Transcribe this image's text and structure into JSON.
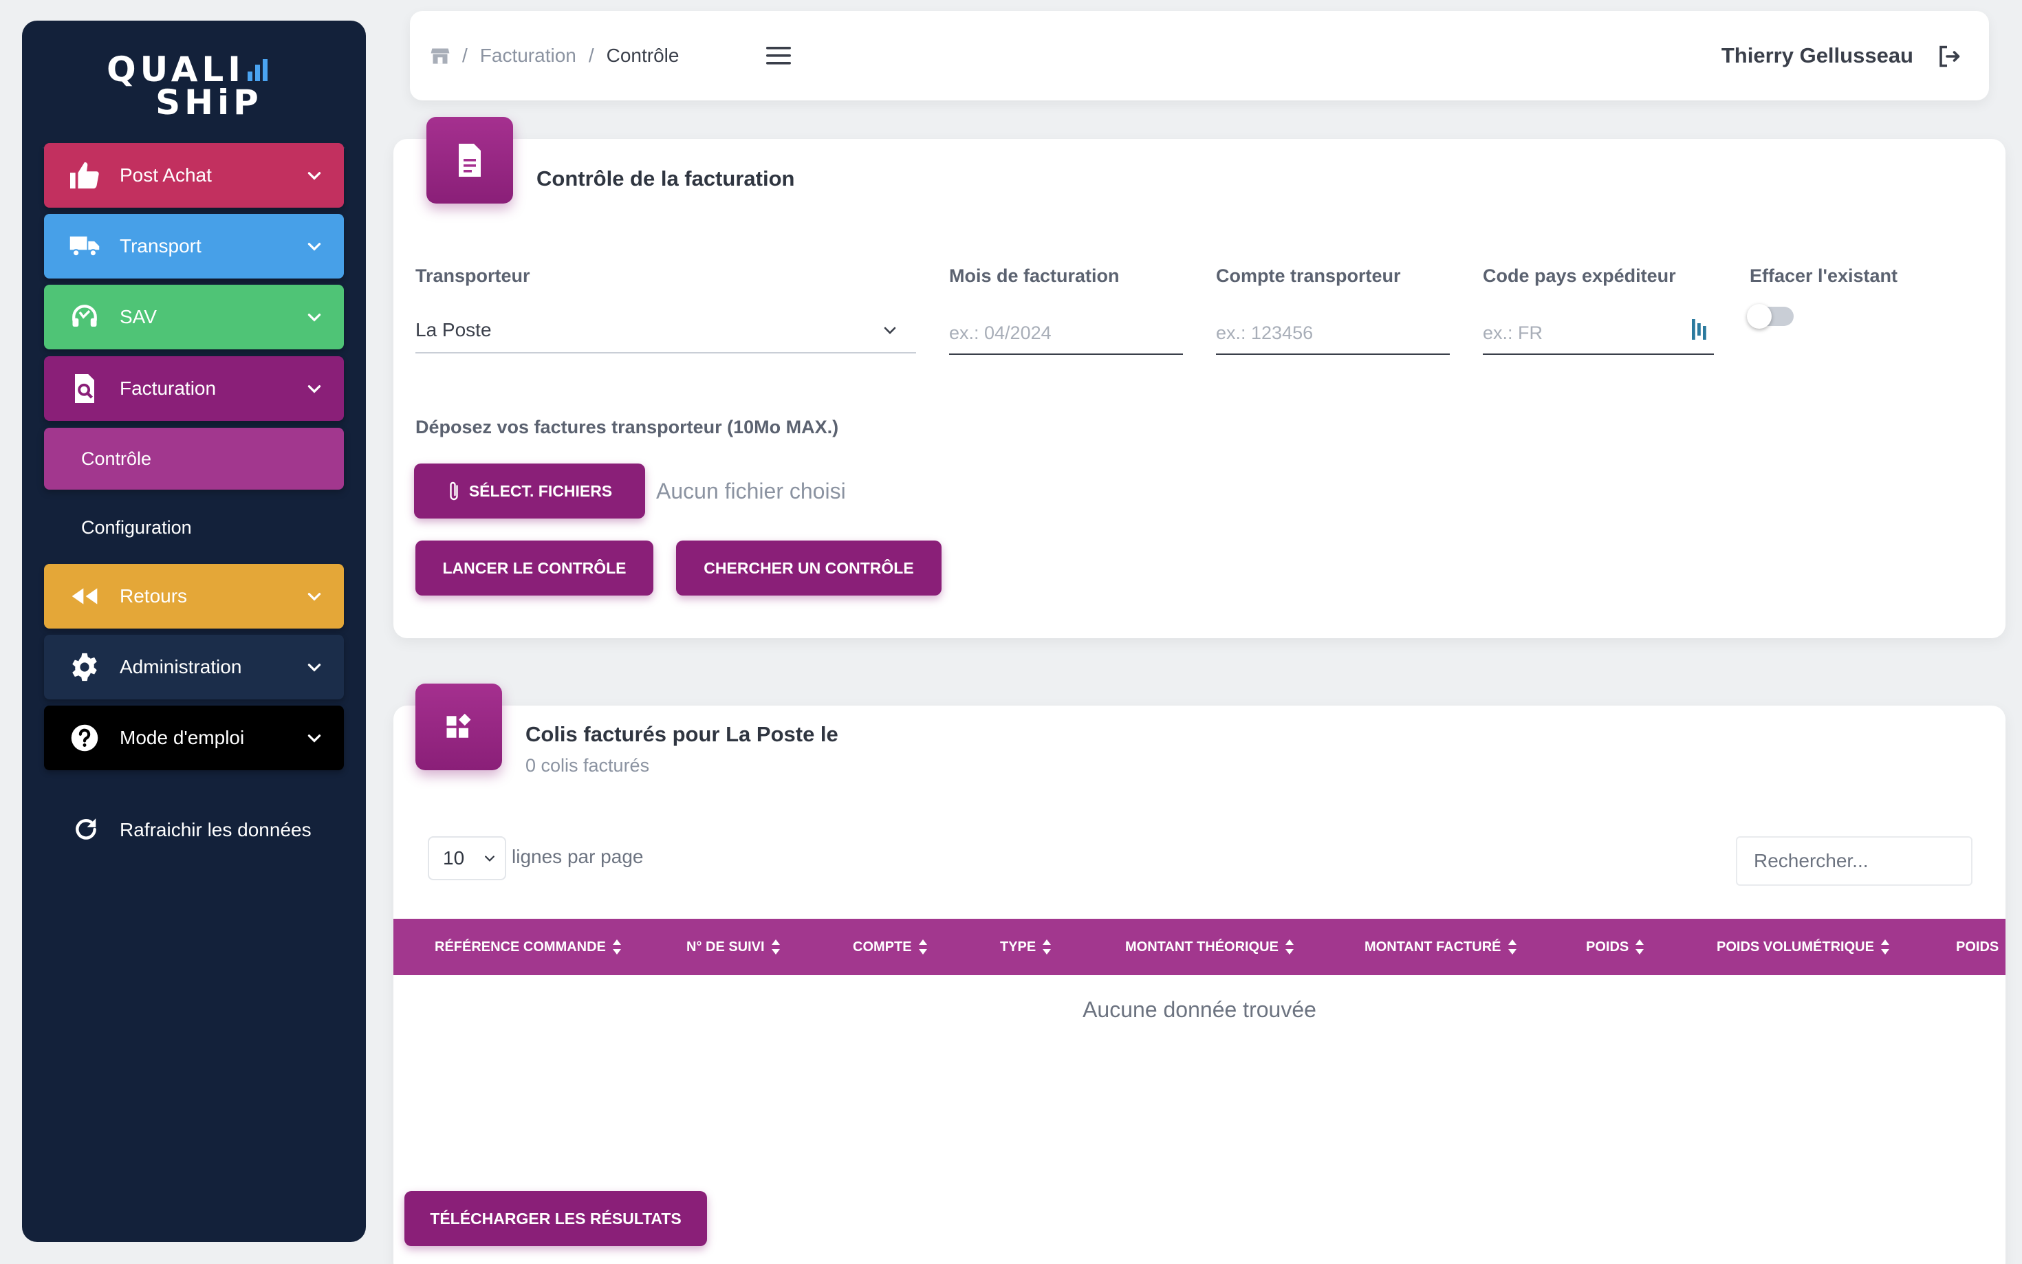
{
  "brand": {
    "line1": "QUALI",
    "line2": "SHiP",
    "accent_color": "#4aa3f0"
  },
  "sidebar": {
    "items": [
      {
        "label": "Post Achat",
        "color": "#c2305f",
        "icon": "thumbs-up-icon"
      },
      {
        "label": "Transport",
        "color": "#47a0e8",
        "icon": "truck-icon"
      },
      {
        "label": "SAV",
        "color": "#4fc476",
        "icon": "headset-icon"
      },
      {
        "label": "Facturation",
        "color": "#8a1f78",
        "icon": "invoice-search-icon"
      },
      {
        "label": "Retours",
        "color": "#e4a738",
        "icon": "rewind-icon"
      },
      {
        "label": "Administration",
        "color": "#1b2d4a",
        "icon": "gear-icon"
      },
      {
        "label": "Mode d'emploi",
        "color": "#000000",
        "icon": "help-icon"
      }
    ],
    "sub_items": [
      {
        "label": "Contrôle",
        "active": true
      },
      {
        "label": "Configuration",
        "active": false
      }
    ],
    "refresh_label": "Rafraichir les données"
  },
  "header": {
    "breadcrumb": {
      "parent": "Facturation",
      "current": "Contrôle",
      "separator": "/"
    },
    "user_name": "Thierry Gellusseau"
  },
  "control_card": {
    "title": "Contrôle de la facturation",
    "fields": {
      "transporteur": {
        "label": "Transporteur",
        "value": "La Poste"
      },
      "mois": {
        "label": "Mois de facturation",
        "placeholder": "ex.: 04/2024"
      },
      "compte": {
        "label": "Compte transporteur",
        "placeholder": "ex.: 123456"
      },
      "code_pays": {
        "label": "Code pays expéditeur",
        "placeholder": "ex.: FR"
      },
      "effacer": {
        "label": "Effacer l'existant",
        "checked": false
      }
    },
    "upload": {
      "label": "Déposez vos factures transporteur (10Mo MAX.)",
      "button_label": "SÉLECT. FICHIERS",
      "no_file_text": "Aucun fichier choisi"
    },
    "launch_button": "LANCER LE CONTRÔLE",
    "search_button": "CHERCHER UN CONTRÔLE"
  },
  "results_card": {
    "title": "Colis facturés pour La Poste le",
    "subtitle": "0 colis facturés",
    "per_page": {
      "value": "10",
      "label": "lignes par page"
    },
    "search_placeholder": "Rechercher...",
    "columns": [
      "RÉFÉRENCE COMMANDE",
      "N° DE SUIVI",
      "COMPTE",
      "TYPE",
      "MONTANT THÉORIQUE",
      "MONTANT FACTURÉ",
      "POIDS",
      "POIDS VOLUMÉTRIQUE",
      "POIDS"
    ],
    "empty_text": "Aucune donnée trouvée",
    "download_button": "TÉLÉCHARGER LES RÉSULTATS"
  }
}
